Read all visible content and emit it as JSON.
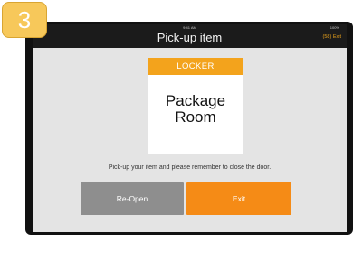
{
  "step": {
    "number": "3"
  },
  "status_bar": {
    "time": "9:41 AM",
    "battery": "100%"
  },
  "header": {
    "title": "Pick-up item",
    "timer_exit": "(58) Exit"
  },
  "locker_card": {
    "header": "LOCKER",
    "line1": "Package",
    "line2": "Room"
  },
  "instruction": "Pick-up your item and please remember to close the door.",
  "buttons": {
    "reopen": "Re-Open",
    "exit": "Exit"
  },
  "colors": {
    "accent": "#f58b16",
    "badge": "#f7c85a",
    "card_header": "#f3a31c",
    "reopen": "#8e8e8e"
  }
}
